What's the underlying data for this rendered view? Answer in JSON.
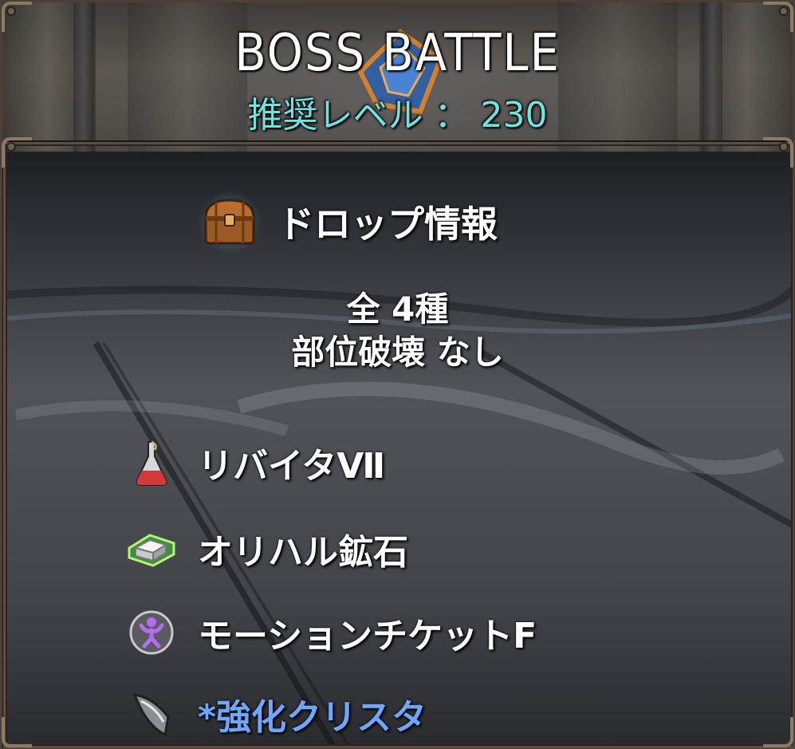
{
  "header": {
    "title": "BOSS BATTLE",
    "recommended_level": "推奨レベル ： 230"
  },
  "drop_info": {
    "heading": "ドロップ情報",
    "heading_icon": "treasure-chest-icon",
    "count_text": "全 4種",
    "part_break_text": "部位破壊 なし",
    "items": [
      {
        "label": "リバイタⅦ",
        "icon": "potion-flask-icon",
        "special": false
      },
      {
        "label": "オリハル鉱石",
        "icon": "ore-ingot-icon",
        "special": false
      },
      {
        "label": "モーションチケットF",
        "icon": "motion-ticket-icon",
        "special": false
      },
      {
        "label": "*強化クリスタ",
        "icon": "crystal-shard-icon",
        "special": true
      }
    ]
  },
  "colors": {
    "level_text": "#6ee3e0",
    "special_item_text": "#6fa6ff",
    "frame": "#5b4f43"
  }
}
